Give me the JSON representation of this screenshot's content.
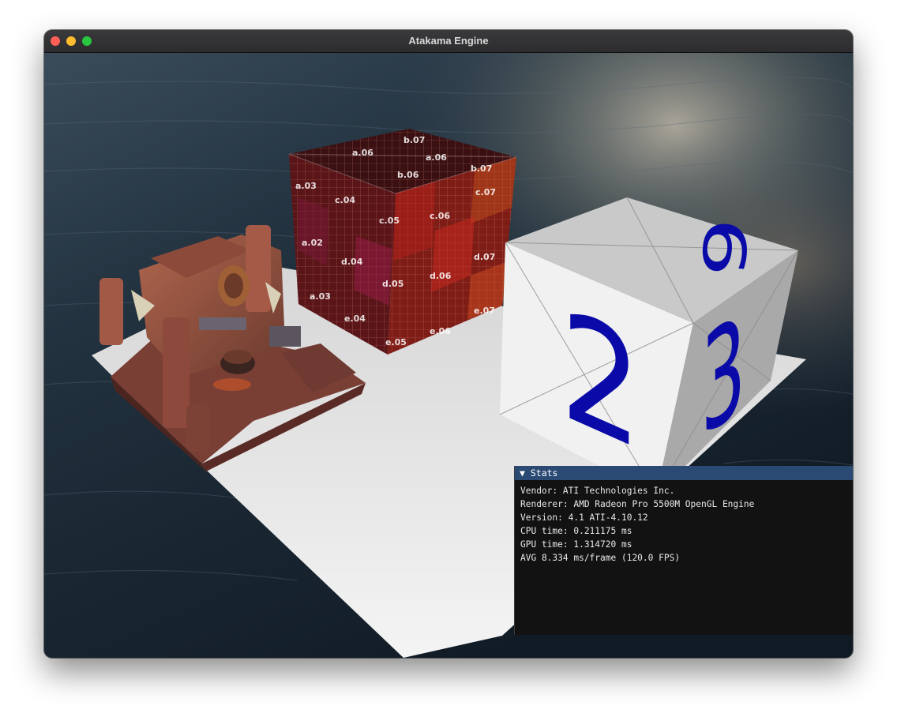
{
  "window": {
    "title": "Atakama Engine"
  },
  "scene": {
    "cube_top_labels": [
      "a.06",
      "b.07",
      "a.06",
      "b.07",
      "b.06"
    ],
    "cube_front_labels": [
      "a.03",
      "c.04",
      "c.05",
      "a.02",
      "d.04",
      "d.05",
      "a.03",
      "e.04",
      "e.05"
    ],
    "cube_right_labels": [
      "c.06",
      "c.07",
      "d.06",
      "d.07",
      "e.06",
      "e.07"
    ],
    "dice_top_number": "6",
    "dice_front_number": "2",
    "dice_right_number": "3",
    "dice_number_color": "#0a0aa8"
  },
  "stats": {
    "header": "▼ Stats",
    "vendor": "Vendor: ATI Technologies Inc.",
    "renderer": "Renderer: AMD Radeon Pro 5500M OpenGL Engine",
    "version": "Version: 4.1 ATI-4.10.12",
    "cpu_time": "CPU time: 0.211175 ms",
    "gpu_time": "GPU time: 1.314720 ms",
    "avg": "AVG 8.334 ms/frame (120.0 FPS)"
  }
}
